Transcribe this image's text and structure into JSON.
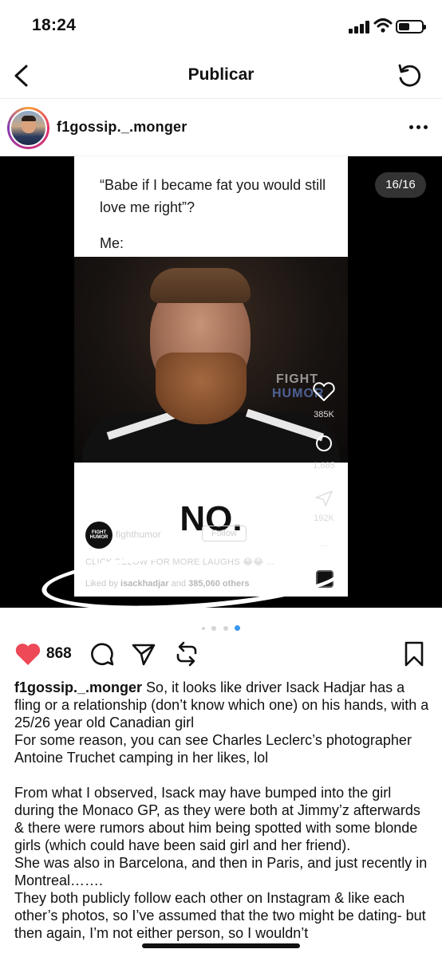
{
  "status_bar": {
    "time": "18:24"
  },
  "header": {
    "title": "Publicar"
  },
  "post": {
    "username": "f1gossip._.monger",
    "slide_counter": "16/16",
    "carousel": {
      "current_index": 4,
      "total_visible_dots": 4
    },
    "meme": {
      "top_text": "“Babe if I became fat you would still love me right”?",
      "me_label": "Me:",
      "watermark_line1": "FIGHT",
      "watermark_line2": "HUMOR",
      "punchline": "NO.",
      "tiktok": {
        "like_count": "385K",
        "comment_count": "1,685",
        "share_count": "192K",
        "more_label": "...",
        "account_logo_text": "FIGHT HUMOR",
        "account_name": "fighthumor",
        "follow_label": "Follow",
        "caption": "CLICK BELOW FOR MORE LAUGHS 😂😂 ...",
        "liked_by_prefix": "Liked by",
        "liked_by_user": "isackhadjar",
        "liked_by_middle": "and",
        "liked_by_count": "385,060 others"
      }
    },
    "actions": {
      "like_count": "868"
    },
    "caption": {
      "username": "f1gossip._.monger",
      "paragraph1": "So, it looks like driver Isack Hadjar has a fling or a relationship (don’t know which one) on his hands, with a 25/26 year old Canadian girl",
      "paragraph2": "For some reason, you can see Charles Leclerc’s photographer Antoine Truchet camping in her likes, lol",
      "paragraph3": "From what I observed, Isack may have bumped into the girl during the Monaco GP, as they were both at Jimmy’z afterwards & there were rumors about him being spotted with some blonde girls (which could have been said girl and her friend).",
      "paragraph4": "She was also in Barcelona, and then in Paris, and just recently in Montreal…….",
      "paragraph5": "They both publicly follow each other on Instagram & like each other’s photos, so I’ve assumed that the two might be dating- but then again, I’m not either person, so I wouldn’t"
    }
  },
  "colors": {
    "like_red": "#ed4956",
    "active_dot": "#3897f0",
    "text": "#111111"
  }
}
